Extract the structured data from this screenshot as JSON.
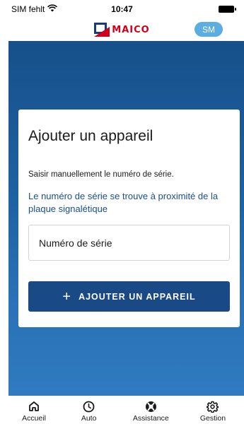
{
  "status_bar": {
    "carrier": "SIM fehlt",
    "time": "10:47"
  },
  "header": {
    "logo_text": "MAICO",
    "avatar_initials": "SM",
    "accent_color": "#d0001c"
  },
  "card": {
    "title": "Ajouter un appareil",
    "instruction": "Saisir manuellement le numéro de série.",
    "hint": "Le numéro de série se trouve à proximité de la plaque signalétique",
    "serial_input": {
      "placeholder": "Numéro de série",
      "value": ""
    },
    "add_button_label": "AJOUTER UN APPAREIL"
  },
  "bottom_nav": {
    "items": [
      {
        "label": "Accueil",
        "icon": "home-icon"
      },
      {
        "label": "Auto",
        "icon": "clock-icon"
      },
      {
        "label": "Assistance",
        "icon": "lifebuoy-icon"
      },
      {
        "label": "Gestion",
        "icon": "gear-icon"
      }
    ]
  },
  "colors": {
    "primary": "#1a4a86",
    "gradient_top": "#17508a",
    "gradient_bottom": "#2f7ac0",
    "avatar_bg": "#5aaee0"
  }
}
